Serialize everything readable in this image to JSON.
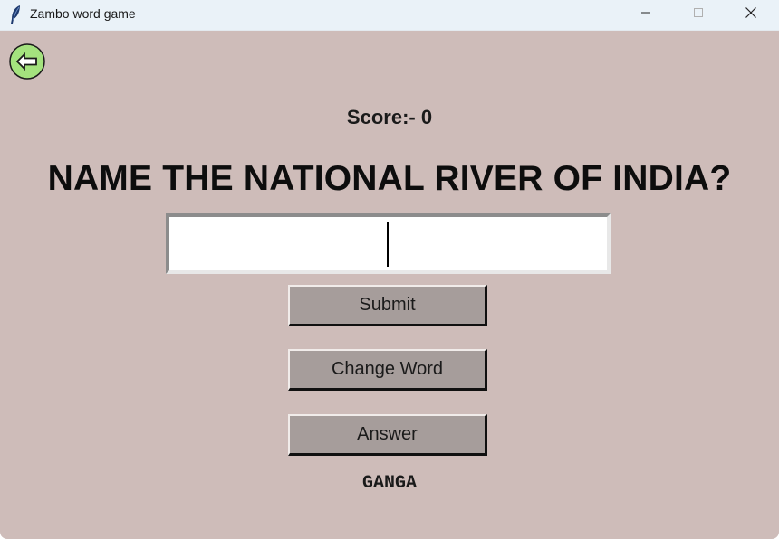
{
  "window": {
    "title": "Zambo word game",
    "icon": "feather-icon",
    "controls": [
      "minimize-icon",
      "maximize-icon",
      "close-icon"
    ]
  },
  "game": {
    "back_icon": "arrow-left-icon",
    "score_text": "Score:- 0",
    "question": "NAME THE NATIONAL RIVER OF INDIA?",
    "input_value": "",
    "buttons": {
      "submit": "Submit",
      "change_word": "Change Word",
      "answer": "Answer"
    },
    "revealed_answer": "GANGA"
  },
  "colors": {
    "background": "#cebcb9",
    "button": "#a69d9b",
    "back_button": "#a4e27e",
    "titlebar": "#eaf2f8"
  }
}
